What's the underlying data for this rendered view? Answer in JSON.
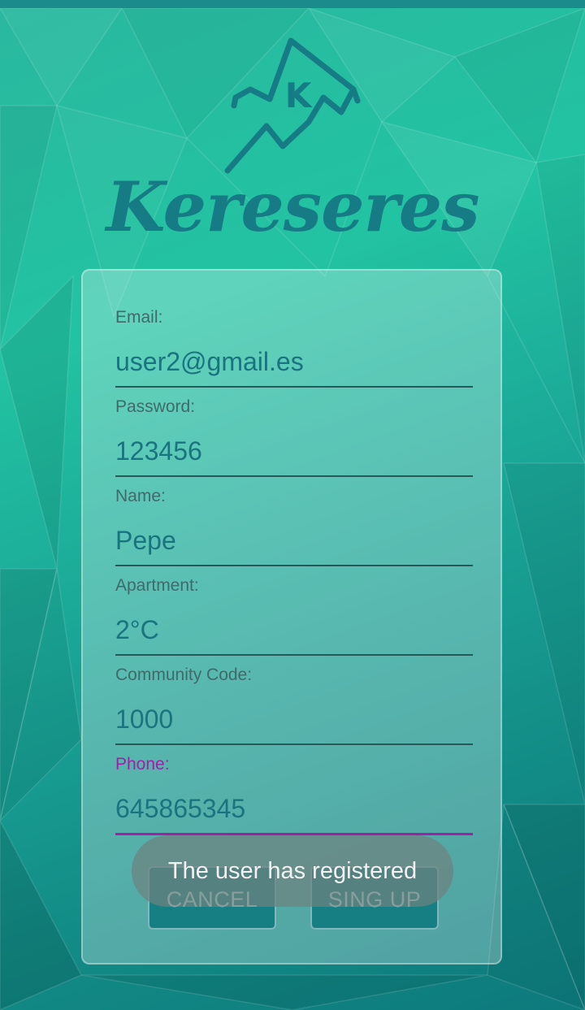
{
  "brand": {
    "logo_letter": "K",
    "name": "Kereseres"
  },
  "form": {
    "email": {
      "label": "Email:",
      "value": "user2@gmail.es"
    },
    "password": {
      "label": "Password:",
      "value": "123456"
    },
    "name": {
      "label": "Name:",
      "value": "Pepe"
    },
    "apartment": {
      "label": "Apartment:",
      "value": "2°C"
    },
    "community_code": {
      "label": "Community Code:",
      "value": "1000"
    },
    "phone": {
      "label": "Phone:",
      "value": "645865345"
    }
  },
  "buttons": {
    "cancel": "CANCEL",
    "signup": "SING UP"
  },
  "toast": {
    "message": "The user has registered"
  },
  "colors": {
    "accent_focus": "#a020a8",
    "brand_teal": "#177b86"
  }
}
